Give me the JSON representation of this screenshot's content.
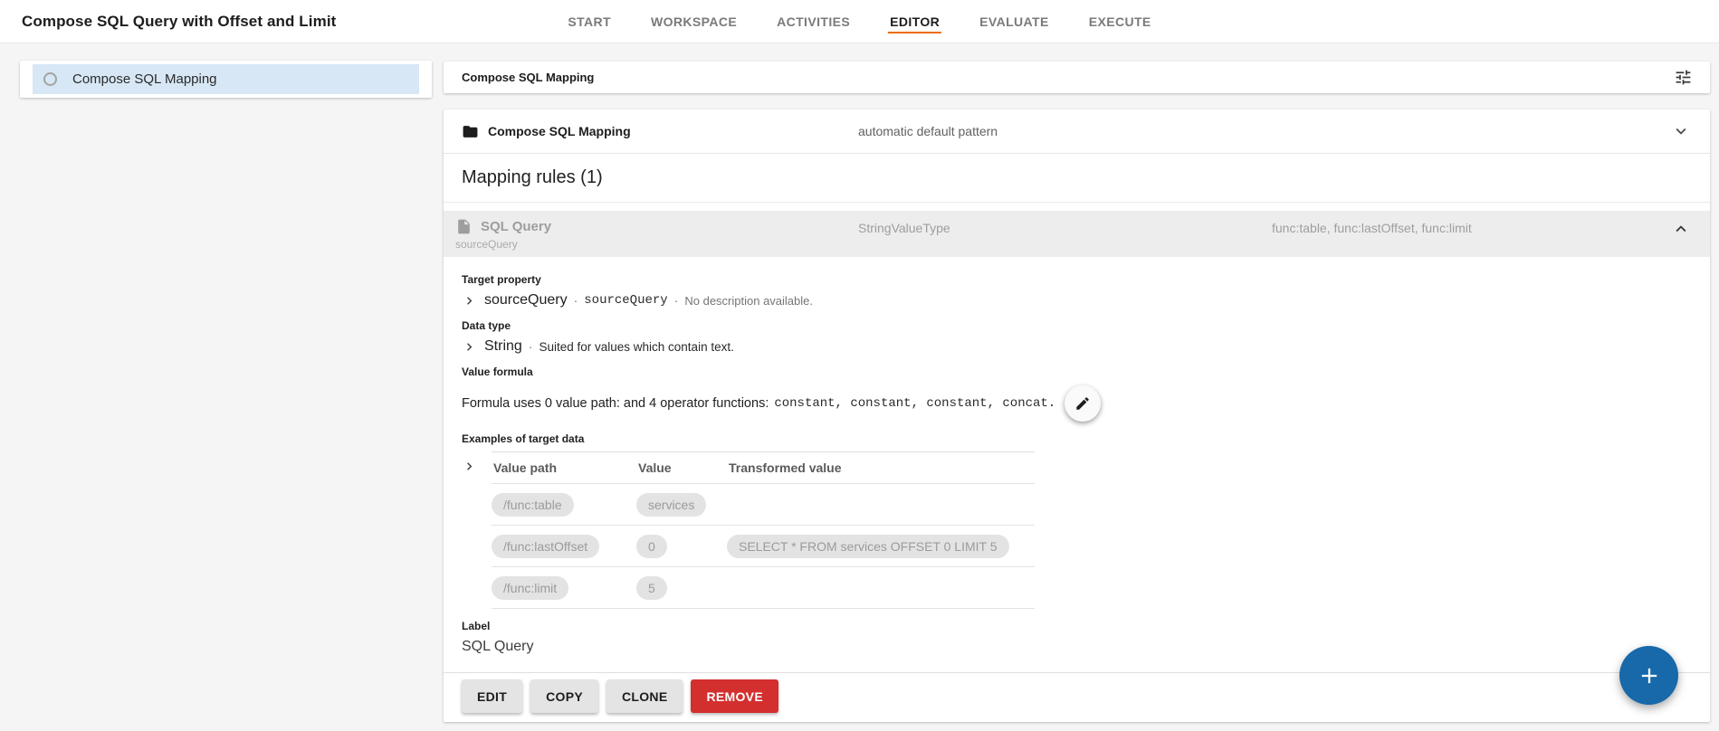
{
  "page": {
    "title": "Compose SQL Query with Offset and Limit"
  },
  "nav": {
    "items": [
      "START",
      "WORKSPACE",
      "ACTIVITIES",
      "EDITOR",
      "EVALUATE",
      "EXECUTE"
    ],
    "active": "EDITOR"
  },
  "sidebar": {
    "item": {
      "label": "Compose SQL Mapping",
      "selected": true
    }
  },
  "panel_header": {
    "title": "Compose SQL Mapping"
  },
  "mapping": {
    "title": "Compose SQL Mapping",
    "pattern": "automatic default pattern",
    "rules_heading": "Mapping rules (1)"
  },
  "rule": {
    "name": "SQL Query",
    "property": "sourceQuery",
    "value_type": "StringValueType",
    "value_paths": "func:table, func:lastOffset, func:limit",
    "target_property": {
      "label": "Target property",
      "name": "sourceQuery",
      "path": "sourceQuery",
      "separator": "·",
      "description": "No description available."
    },
    "data_type": {
      "label": "Data type",
      "name": "String",
      "separator": "·",
      "description": "Suited for values which contain text."
    },
    "value_formula": {
      "label": "Value formula",
      "summary": "Formula uses 0 value path:  and 4 operator functions:",
      "functions": "constant, constant, constant, concat."
    },
    "examples": {
      "label": "Examples of target data",
      "columns": [
        "Value path",
        "Value",
        "Transformed value"
      ],
      "rows": [
        {
          "value_path": "/func:table",
          "value": "services",
          "transformed": ""
        },
        {
          "value_path": "/func:lastOffset",
          "value": "0",
          "transformed": "SELECT * FROM services OFFSET 0 LIMIT 5"
        },
        {
          "value_path": "/func:limit",
          "value": "5",
          "transformed": ""
        }
      ]
    },
    "label_field": {
      "label": "Label",
      "value": "SQL Query"
    },
    "actions": {
      "edit": "EDIT",
      "copy": "COPY",
      "clone": "CLONE",
      "remove": "REMOVE"
    }
  },
  "fab": {
    "icon": "plus"
  },
  "colors": {
    "accent_orange": "#ef6c00",
    "selected_item_blue": "#d7e7f5",
    "fab_blue": "#1769aa",
    "danger_red": "#d32f2f",
    "rule_header_gray": "#ededed",
    "chip_gray": "#e3e3e3"
  }
}
